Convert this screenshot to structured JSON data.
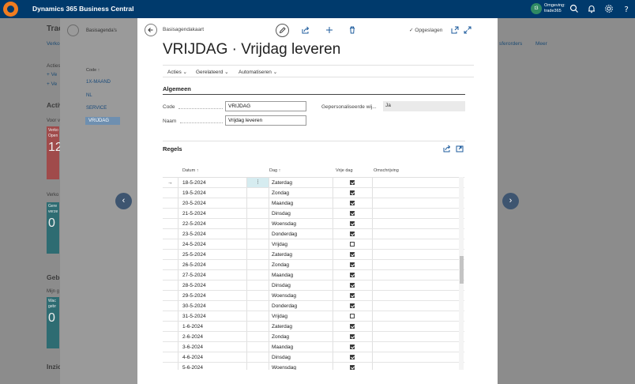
{
  "topbar": {
    "app_title": "Dynamics 365 Business Central",
    "env_initials": "t3",
    "env_line1": "Omgeving:",
    "env_line2": "trade365"
  },
  "background": {
    "title": "Trac",
    "link1": "Verko",
    "link2": "sferorders",
    "more": "Meer",
    "actions_label": "Acties",
    "action1": "+ Ve",
    "action2": "+ Ve",
    "activity": "Activ",
    "tile_label": "Voor v",
    "tile1_text": "Verko Open",
    "tile1_value": "12",
    "tile2_label": "Verko",
    "tile2_text": "Gere verze",
    "tile2_value": "0",
    "usage": "Gebr",
    "tile3_label": "Mijn g",
    "tile3_text": "Wac gebr",
    "tile3_value": "0",
    "bottom": "Inzic"
  },
  "list_panel": {
    "title": "Basisagenda's",
    "col_header": "Code ↑",
    "items": [
      "1X-MAAND",
      "NL",
      "SERVICE",
      "VRIJDAG"
    ]
  },
  "modal": {
    "breadcrumb": "Basisagendakaart",
    "saved": "Opgeslagen",
    "title": "VRIJDAG · Vrijdag leveren",
    "actions": [
      "Acties",
      "Gerelateerd",
      "Automatiseren"
    ],
    "general_header": "Algemeen",
    "code_label": "Code",
    "code_value": "VRIJDAG",
    "name_label": "Naam",
    "name_value": "Vrijdag leveren",
    "custom_label": "Gepersonaliseerde wij...",
    "custom_value": "Ja",
    "lines_header": "Regels",
    "columns": {
      "date": "Datum ↑",
      "day": "Dag ↑",
      "free": "Vrije dag",
      "desc": "Omschrijving"
    },
    "rows": [
      {
        "date": "18-5-2024",
        "day": "Zaterdag",
        "free": true
      },
      {
        "date": "19-5-2024",
        "day": "Zondag",
        "free": true
      },
      {
        "date": "20-5-2024",
        "day": "Maandag",
        "free": true
      },
      {
        "date": "21-5-2024",
        "day": "Dinsdag",
        "free": true
      },
      {
        "date": "22-5-2024",
        "day": "Woensdag",
        "free": true
      },
      {
        "date": "23-5-2024",
        "day": "Donderdag",
        "free": true
      },
      {
        "date": "24-5-2024",
        "day": "Vrijdag",
        "free": false
      },
      {
        "date": "25-5-2024",
        "day": "Zaterdag",
        "free": true
      },
      {
        "date": "26-5-2024",
        "day": "Zondag",
        "free": true
      },
      {
        "date": "27-5-2024",
        "day": "Maandag",
        "free": true
      },
      {
        "date": "28-5-2024",
        "day": "Dinsdag",
        "free": true
      },
      {
        "date": "29-5-2024",
        "day": "Woensdag",
        "free": true
      },
      {
        "date": "30-5-2024",
        "day": "Donderdag",
        "free": true
      },
      {
        "date": "31-5-2024",
        "day": "Vrijdag",
        "free": false
      },
      {
        "date": "1-6-2024",
        "day": "Zaterdag",
        "free": true
      },
      {
        "date": "2-6-2024",
        "day": "Zondag",
        "free": true
      },
      {
        "date": "3-6-2024",
        "day": "Maandag",
        "free": true
      },
      {
        "date": "4-6-2024",
        "day": "Dinsdag",
        "free": true
      },
      {
        "date": "5-6-2024",
        "day": "Woensdag",
        "free": true
      }
    ]
  },
  "icons": {
    "back": "back-arrow-icon",
    "edit": "pencil-icon",
    "share": "share-icon",
    "add": "plus-icon",
    "delete": "trash-icon",
    "expand": "expand-icon",
    "popout": "open-in-new-window-icon",
    "search": "search-icon",
    "bell": "bell-icon",
    "settings": "gear-icon",
    "help": "help-icon"
  },
  "colors": {
    "topbar": "#003a6c",
    "tile_red": "#c85a5a",
    "tile_teal": "#2f7f87",
    "selected": "#6e8fb0"
  }
}
